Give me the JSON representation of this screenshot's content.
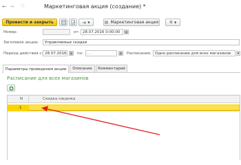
{
  "window": {
    "title": "Маркетинговая акция (создание) *"
  },
  "toolbar": {
    "post_close_label": "Провести и закрыть",
    "marketing_action_label": "Маркетинговая акция"
  },
  "form": {
    "number_label": "Номер:",
    "number_value": "",
    "from_label": "от:",
    "date_value": "28.07.2016  0:00:00",
    "header_label": "Заголовок акции:",
    "header_value": "Управляемые скидки",
    "period_label": "Период действия с:",
    "period_from": "28.07.2016",
    "period_to_label": "по:",
    "period_to": " .  .",
    "schedule_label": "Расписание:",
    "schedule_value": "Одно расписание для всех магазинов"
  },
  "tabs": [
    {
      "label": "Параметры проведения акции"
    },
    {
      "label": "Описание"
    },
    {
      "label": "Комментарий"
    }
  ],
  "section": {
    "title": "Расписание для всех магазинов"
  },
  "table": {
    "columns": [
      "N",
      "Скидка наценка"
    ],
    "rows": [
      {
        "n": "1",
        "discount": ""
      }
    ]
  },
  "colors": {
    "primary_button": "#f7d21c",
    "row_highlight": "#fbd300",
    "section_title": "#4b9a3c",
    "arrow": "#e02020"
  }
}
